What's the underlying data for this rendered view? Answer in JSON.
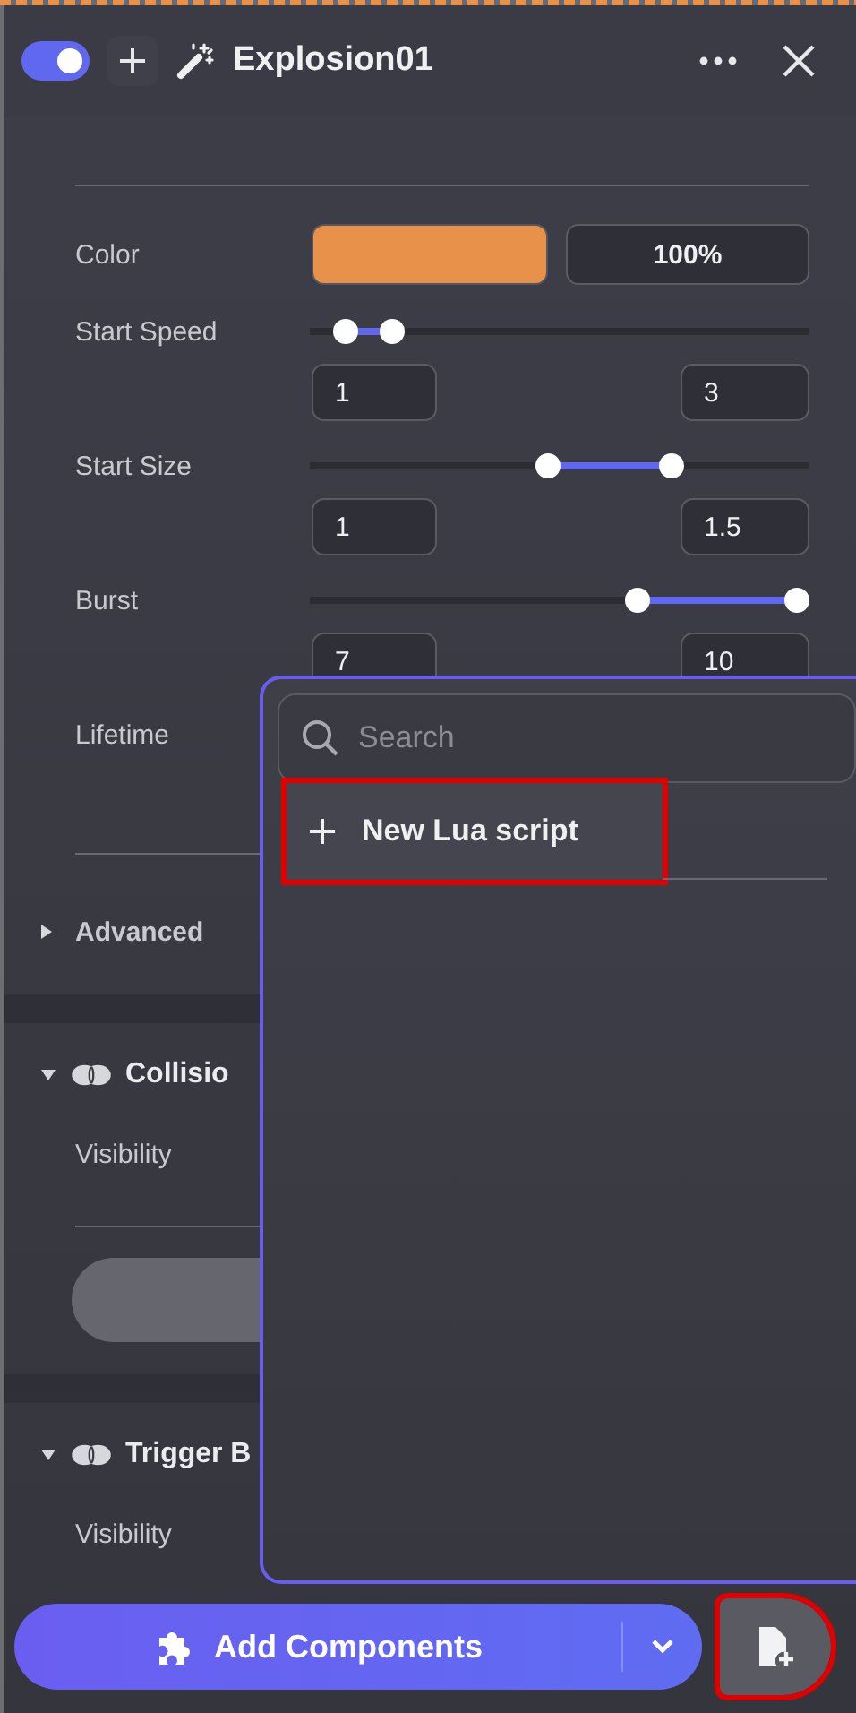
{
  "header": {
    "enabled": true,
    "title": "Explosion01"
  },
  "properties": [
    {
      "kind": "color",
      "label": "Color",
      "color": "#e8914a",
      "value": "100%"
    },
    {
      "kind": "range",
      "label": "Start Speed",
      "thumbs": [
        {
          "level": 0.07
        },
        {
          "level": 0.165
        }
      ],
      "min_value": "1",
      "max_value": "3"
    },
    {
      "kind": "range",
      "label": "Start Size",
      "thumbs": [
        {
          "level": 0.475
        },
        {
          "level": 0.725
        }
      ],
      "min_value": "1",
      "max_value": "1.5"
    },
    {
      "kind": "range",
      "label": "Burst",
      "thumbs": [
        {
          "level": 0.655
        },
        {
          "level": 0.975
        }
      ],
      "min_value": "7",
      "max_value": "10"
    },
    {
      "kind": "plain",
      "label": "Lifetime"
    }
  ],
  "advanced": {
    "label": "Advanced",
    "expanded": false
  },
  "components": [
    {
      "kind": "collision",
      "title": "Collisio",
      "expanded": true,
      "visibility_label": "Visibility"
    },
    {
      "kind": "trigger",
      "title": "Trigger B",
      "expanded": true,
      "visibility_label": "Visibility"
    }
  ],
  "menu": {
    "search_placeholder": "Search",
    "items": [
      {
        "label": "New Lua script",
        "highlighted": true
      }
    ]
  },
  "footer": {
    "add_label": "Add Components",
    "new_file_highlighted": true
  }
}
